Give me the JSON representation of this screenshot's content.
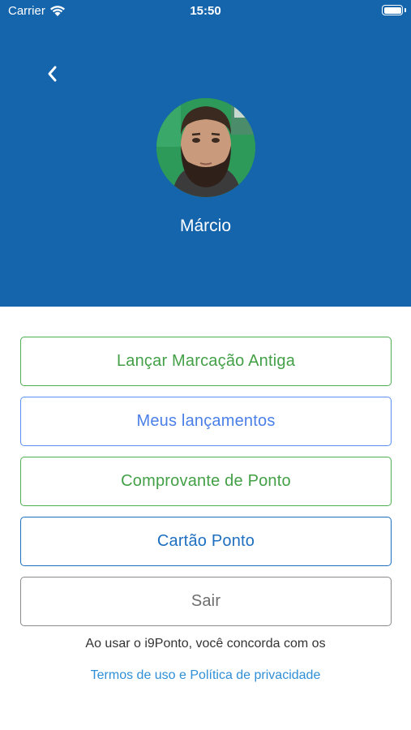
{
  "status_bar": {
    "carrier": "Carrier",
    "time": "15:50"
  },
  "header": {
    "background_color": "#1565ad",
    "back_icon": "chevron-left-icon",
    "user_name": "Márcio"
  },
  "menu": {
    "buttons": [
      {
        "label": "Lançar Marcação Antiga",
        "color": "#43a047"
      },
      {
        "label": "Meus lançamentos",
        "color": "#4a7fe8"
      },
      {
        "label": "Comprovante de Ponto",
        "color": "#43a047"
      },
      {
        "label": "Cartão Ponto",
        "color": "#1e6fc0"
      },
      {
        "label": "Sair",
        "color": "#6e6e6e"
      }
    ]
  },
  "footer": {
    "consent_text": "Ao usar o i9Ponto, você concorda com os",
    "terms_link": "Termos de uso e Política de privacidade"
  }
}
